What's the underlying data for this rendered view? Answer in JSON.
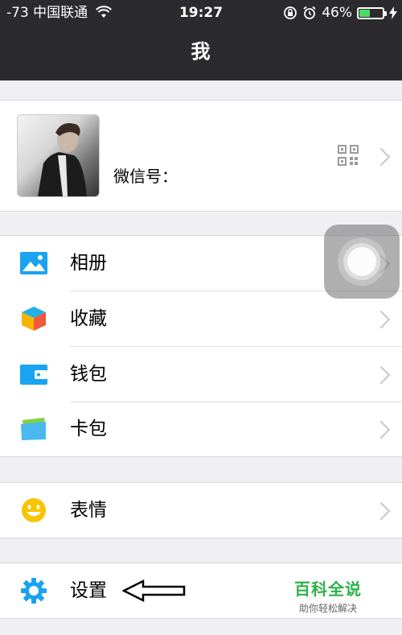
{
  "status_bar": {
    "carrier": "-73 中国联通",
    "time": "19:27",
    "battery": "46%",
    "battery_level": 0.46
  },
  "nav": {
    "title": "我"
  },
  "profile": {
    "wechat_id_label": "微信号："
  },
  "menu": {
    "album": "相册",
    "favorites": "收藏",
    "wallet": "钱包",
    "cards": "卡包",
    "stickers": "表情",
    "settings": "设置"
  },
  "watermark": {
    "brand": "百科全说",
    "slogan": "助你轻松解决"
  },
  "colors": {
    "nav_bg": "#2b2b2e",
    "page_bg": "#efeff4",
    "icon_blue": "#1aa3f0",
    "icon_yellow": "#f7c600",
    "battery_green": "#4cd964",
    "watermark_green": "#2db14a"
  }
}
